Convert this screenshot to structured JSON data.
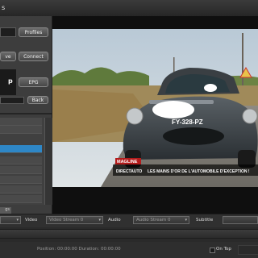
{
  "window": {
    "title": "s"
  },
  "left_panel": {
    "profiles_label": "Profiles",
    "remove_label": "ve",
    "connect_label": "Connect",
    "epg_label": "EPG",
    "back_label": "Back",
    "playing_label": "p",
    "tab_label": "gs",
    "channel_rows": [
      "",
      "",
      "",
      "",
      "",
      "",
      "",
      "",
      ""
    ]
  },
  "video": {
    "logo_brand": "MAGLINE",
    "caption": "LES MAINS D'OR DE L'AUTOMOBILE D'EXCEPTION !",
    "channel": "DIRECTAUTO",
    "plate": "FY-328-PZ"
  },
  "controls": {
    "video_label": "Video",
    "video_stream": "Video Stream 0",
    "audio_label": "Audio",
    "audio_stream": "Audio Stream 0",
    "subtitle_label": "Subtitle",
    "status_text": "Position: 00:00:00 Duration: 00:00:00",
    "ontop_label": "On Top"
  }
}
